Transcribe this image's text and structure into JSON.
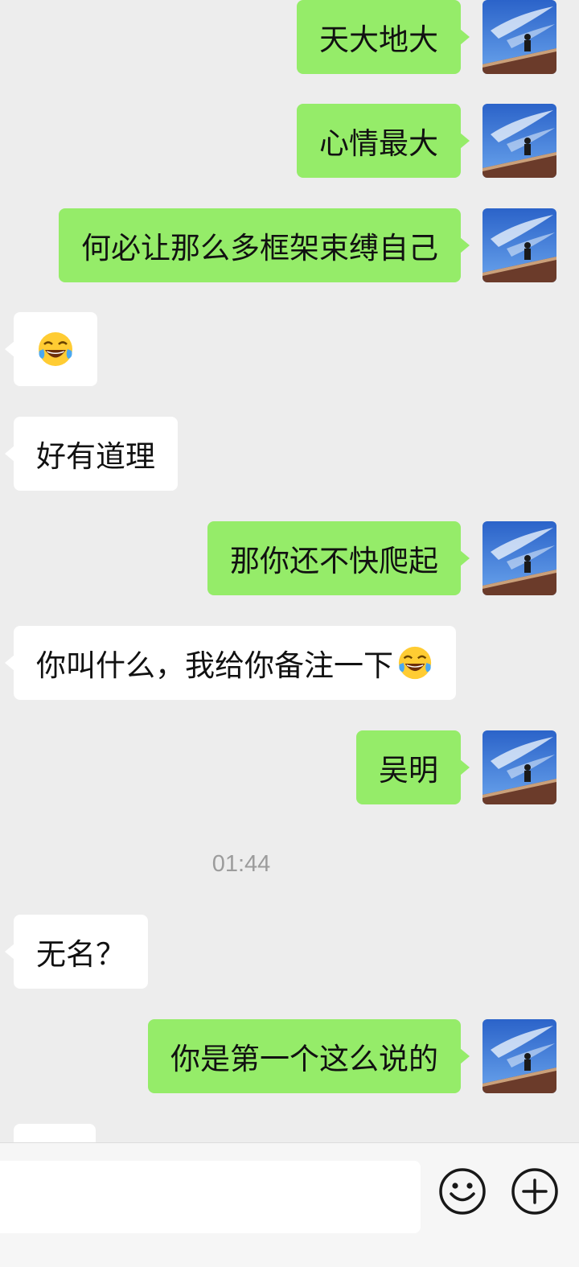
{
  "colors": {
    "background": "#ededed",
    "outgoing_bubble": "#95ec69",
    "incoming_bubble": "#ffffff",
    "timestamp_text": "#9c9c9c"
  },
  "messages": [
    {
      "direction": "out",
      "text": "天大地大"
    },
    {
      "direction": "out",
      "text": "心情最大"
    },
    {
      "direction": "out",
      "text": "何必让那么多框架束缚自己"
    },
    {
      "direction": "in",
      "text": "",
      "emoji": "tears-of-joy-emoji"
    },
    {
      "direction": "in",
      "text": "好有道理"
    },
    {
      "direction": "out",
      "text": "那你还不快爬起"
    },
    {
      "direction": "in",
      "text": "你叫什么，我给你备注一下",
      "emoji": "tears-of-joy-emoji"
    },
    {
      "direction": "out",
      "text": "吴明"
    },
    {
      "direction": "in",
      "text": "无名？"
    },
    {
      "direction": "out",
      "text": "你是第一个这么说的"
    }
  ],
  "timestamp": "01:44",
  "input_bar": {
    "text_value": "",
    "emoji_button_icon": "smiley-face-icon",
    "more_button_icon": "plus-circle-icon"
  }
}
